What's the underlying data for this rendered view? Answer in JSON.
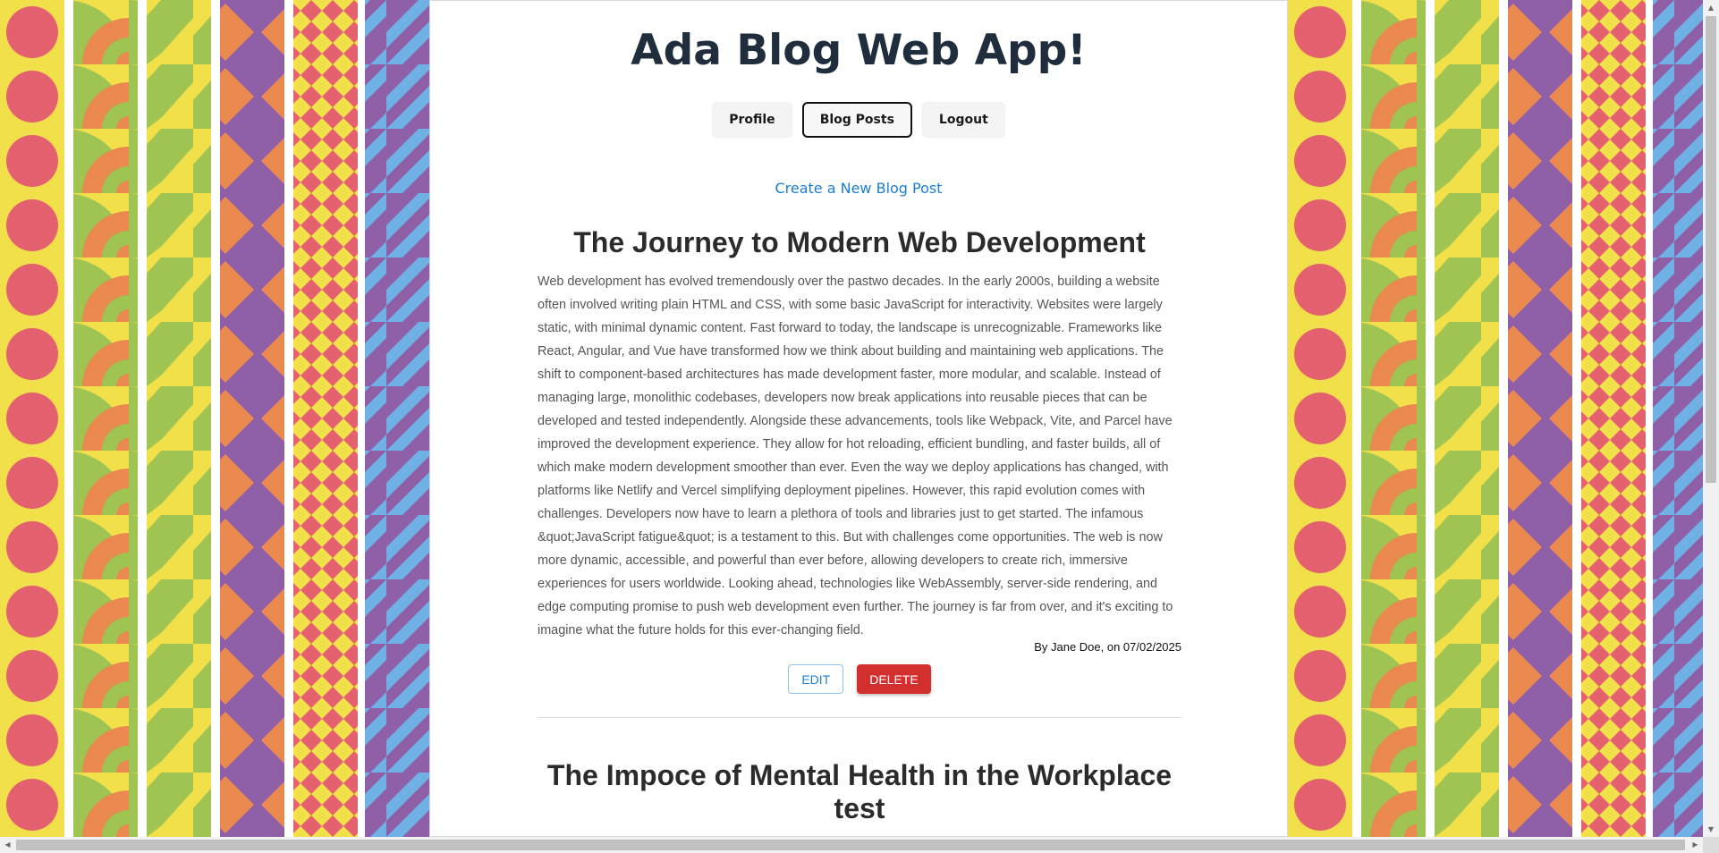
{
  "app": {
    "title": "Ada Blog Web App!"
  },
  "nav": {
    "items": [
      {
        "label": "Profile",
        "active": false
      },
      {
        "label": "Blog Posts",
        "active": true
      },
      {
        "label": "Logout",
        "active": false
      }
    ]
  },
  "create_link": {
    "label": "Create a New Blog Post"
  },
  "posts": [
    {
      "title": "The Journey to Modern Web Development",
      "body": "Web development has evolved tremendously over the pastwo decades. In the early 2000s, building a website often involved writing plain HTML and CSS, with some basic JavaScript for interactivity. Websites were largely static, with minimal dynamic content. Fast forward to today, the landscape is unrecognizable. Frameworks like React, Angular, and Vue have transformed how we think about building and maintaining web applications. The shift to component-based architectures has made development faster, more modular, and scalable. Instead of managing large, monolithic codebases, developers now break applications into reusable pieces that can be developed and tested independently. Alongside these advancements, tools like Webpack, Vite, and Parcel have improved the development experience. They allow for hot reloading, efficient bundling, and faster builds, all of which make modern development smoother than ever. Even the way we deploy applications has changed, with platforms like Netlify and Vercel simplifying deployment pipelines. However, this rapid evolution comes with challenges. Developers now have to learn a plethora of tools and libraries just to get started. The infamous &quot;JavaScript fatigue&quot; is a testament to this. But with challenges come opportunities. The web is now more dynamic, accessible, and powerful than ever before, allowing developers to create rich, immersive experiences for users worldwide. Looking ahead, technologies like WebAssembly, server-side rendering, and edge computing promise to push web development even further. The journey is far from over, and it's exciting to imagine what the future holds for this ever-changing field.",
      "meta": "By Jane Doe, on 07/02/2025",
      "edit_label": "EDIT",
      "delete_label": "DELETE"
    },
    {
      "title": "The Impoce of Mental Health in the Workplace test"
    }
  ],
  "colors": {
    "title": "#1f2d3d",
    "link": "#1a7fd4",
    "delete": "#d32f2f",
    "edit_border": "#90c2ec",
    "pattern_yellow": "#f2e04a",
    "pattern_red": "#e5606e",
    "pattern_orange": "#e9894f",
    "pattern_green": "#9fc452",
    "pattern_purple": "#8e5ea6",
    "pattern_blue": "#6fb1e4"
  },
  "scrollbars": {
    "vertical_position": 0,
    "horizontal_position": 0
  }
}
